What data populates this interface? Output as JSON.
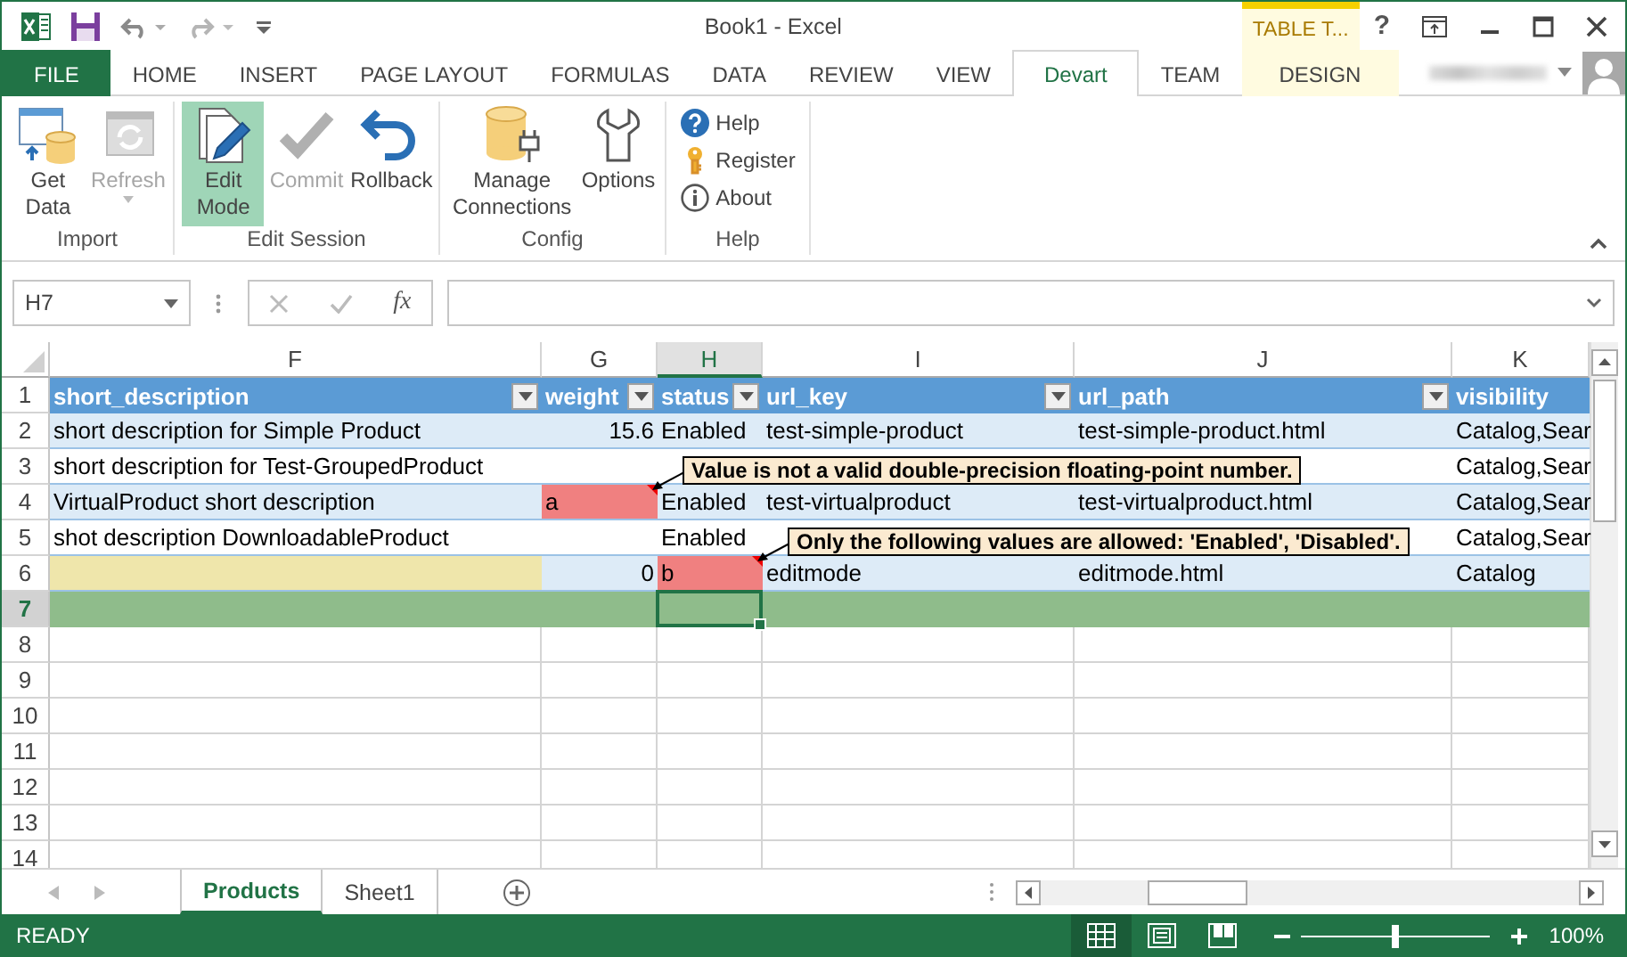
{
  "window": {
    "title": "Book1 - Excel",
    "context_label": "TABLE T...",
    "help": "?"
  },
  "tabs": [
    {
      "label": "FILE",
      "kind": "file",
      "selected": false
    },
    {
      "label": "HOME",
      "kind": "normal",
      "selected": false
    },
    {
      "label": "INSERT",
      "kind": "normal",
      "selected": false
    },
    {
      "label": "PAGE LAYOUT",
      "kind": "normal",
      "selected": false
    },
    {
      "label": "FORMULAS",
      "kind": "normal",
      "selected": false
    },
    {
      "label": "DATA",
      "kind": "normal",
      "selected": false
    },
    {
      "label": "REVIEW",
      "kind": "normal",
      "selected": false
    },
    {
      "label": "VIEW",
      "kind": "normal",
      "selected": false
    },
    {
      "label": "Devart",
      "kind": "normal",
      "selected": true
    },
    {
      "label": "TEAM",
      "kind": "normal",
      "selected": false
    },
    {
      "label": "DESIGN",
      "kind": "contextual",
      "selected": false
    }
  ],
  "ribbon": {
    "groups": [
      {
        "name": "Import",
        "buttons": [
          {
            "label": "Get Data",
            "disabled": false,
            "selected": false
          },
          {
            "label": "Refresh",
            "disabled": true,
            "selected": false
          }
        ]
      },
      {
        "name": "Edit Session",
        "buttons": [
          {
            "label": "Edit Mode",
            "disabled": false,
            "selected": true
          },
          {
            "label": "Commit",
            "disabled": true,
            "selected": false
          },
          {
            "label": "Rollback",
            "disabled": false,
            "selected": false
          }
        ]
      },
      {
        "name": "Config",
        "buttons": [
          {
            "label": "Manage Connections",
            "disabled": false,
            "selected": false
          },
          {
            "label": "Options",
            "disabled": false,
            "selected": false
          }
        ]
      },
      {
        "name": "Help",
        "links": [
          {
            "label": "Help"
          },
          {
            "label": "Register"
          },
          {
            "label": "About"
          }
        ]
      }
    ]
  },
  "name_box": "H7",
  "formula_bar": {
    "function_label": "fx"
  },
  "columns": [
    {
      "letter": "F",
      "header": "short_description",
      "filter": true,
      "selected": false
    },
    {
      "letter": "G",
      "header": "weight",
      "filter": true,
      "selected": false
    },
    {
      "letter": "H",
      "header": "status",
      "filter": true,
      "selected": true
    },
    {
      "letter": "I",
      "header": "url_key",
      "filter": true,
      "selected": false
    },
    {
      "letter": "J",
      "header": "url_path",
      "filter": true,
      "selected": false
    },
    {
      "letter": "K",
      "header": "visibility",
      "filter": false,
      "selected": false
    }
  ],
  "header_row": "1",
  "rows": [
    {
      "number": "2",
      "kind": "data",
      "selected": false,
      "cells": [
        {
          "text": "short description for Simple Product",
          "kind": "text"
        },
        {
          "text": "15.6",
          "kind": "number"
        },
        {
          "text": "Enabled",
          "kind": "text"
        },
        {
          "text": "test-simple-product",
          "kind": "text"
        },
        {
          "text": "test-simple-product.html",
          "kind": "text"
        },
        {
          "text": "Catalog,Sear",
          "kind": "text"
        }
      ]
    },
    {
      "number": "3",
      "kind": "data",
      "selected": false,
      "cells": [
        {
          "text": "short description for Test-GroupedProduct",
          "kind": "text"
        },
        {
          "kind": "text"
        },
        {
          "kind": "text"
        },
        {
          "kind": "text"
        },
        {
          "kind": "text"
        },
        {
          "text": "Catalog,Sear",
          "kind": "text"
        }
      ]
    },
    {
      "number": "4",
      "kind": "data",
      "selected": false,
      "cells": [
        {
          "text": "VirtualProduct  short description",
          "kind": "text"
        },
        {
          "text": "a",
          "kind": "invalid"
        },
        {
          "text": "Enabled",
          "kind": "text"
        },
        {
          "text": "test-virtualproduct",
          "kind": "text"
        },
        {
          "text": "test-virtualproduct.html",
          "kind": "text"
        },
        {
          "text": "Catalog,Sear",
          "kind": "text"
        }
      ]
    },
    {
      "number": "5",
      "kind": "data",
      "selected": false,
      "cells": [
        {
          "text": "shot description DownloadableProduct",
          "kind": "text"
        },
        {
          "kind": "text"
        },
        {
          "text": "Enabled",
          "kind": "text"
        },
        {
          "kind": "text"
        },
        {
          "kind": "text"
        },
        {
          "text": "Catalog,Sear",
          "kind": "text"
        }
      ]
    },
    {
      "number": "6",
      "kind": "data",
      "selected": false,
      "cells": [
        {
          "kind": "edited"
        },
        {
          "text": "0",
          "kind": "number"
        },
        {
          "text": "b",
          "kind": "invalid"
        },
        {
          "text": "editmode",
          "kind": "text"
        },
        {
          "text": "editmode.html",
          "kind": "text"
        },
        {
          "text": "Catalog",
          "kind": "text"
        }
      ]
    },
    {
      "number": "7",
      "kind": "new",
      "selected": true
    }
  ],
  "empty_rows": [
    "8",
    "9",
    "10",
    "11",
    "12",
    "13",
    "14"
  ],
  "tooltips": [
    {
      "text": "Value is not a valid double-precision floating-point number."
    },
    {
      "text": "Only the following values are allowed: 'Enabled', 'Disabled'."
    }
  ],
  "sheets": [
    {
      "label": "Products",
      "selected": true
    },
    {
      "label": "Sheet1",
      "selected": false
    }
  ],
  "status_bar": {
    "text": "READY",
    "views": [
      {
        "kind": "normal",
        "selected": true
      },
      {
        "kind": "page-layout",
        "selected": false
      },
      {
        "kind": "page-break",
        "selected": false
      }
    ],
    "zoom": {
      "level": 0.5,
      "reading": "100%"
    }
  }
}
